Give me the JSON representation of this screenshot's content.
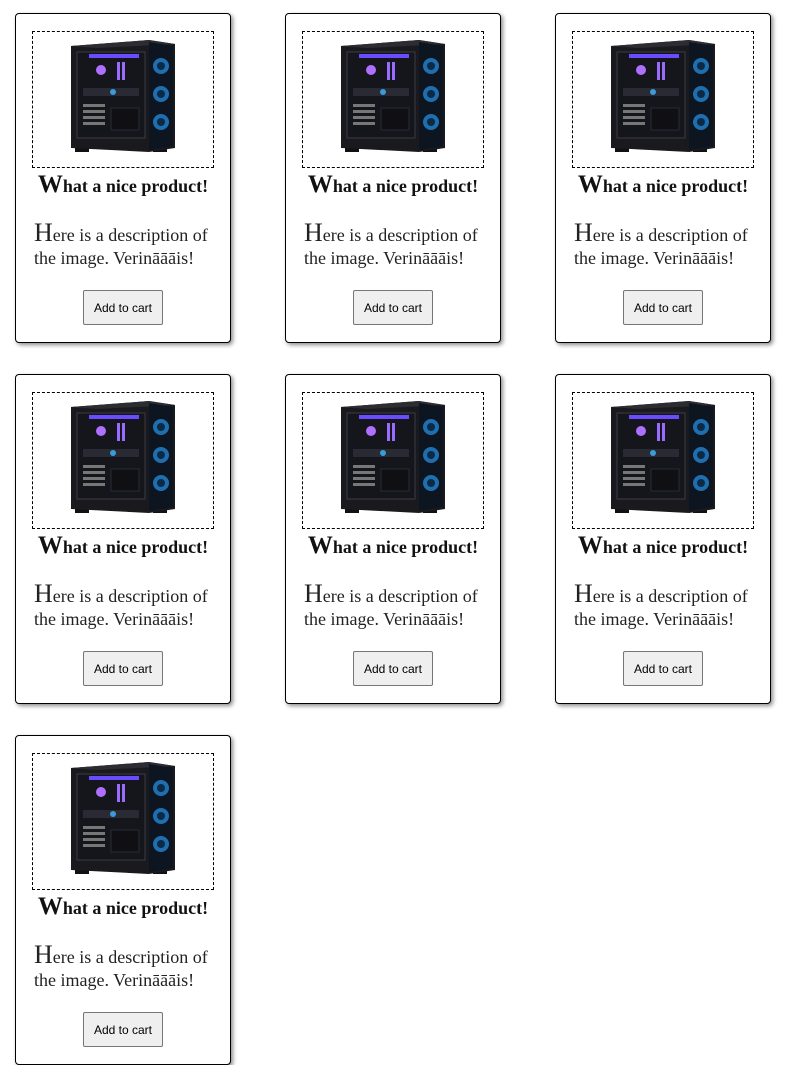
{
  "products": [
    {
      "title_initial": "W",
      "title_rest": "hat a nice product!",
      "desc_initial": "H",
      "desc_rest": "ere is a description of the image. Verināāāis!",
      "button_label": "Add to cart",
      "image_icon": "pc-tower-icon"
    },
    {
      "title_initial": "W",
      "title_rest": "hat a nice product!",
      "desc_initial": "H",
      "desc_rest": "ere is a description of the image. Verināāāis!",
      "button_label": "Add to cart",
      "image_icon": "pc-tower-icon"
    },
    {
      "title_initial": "W",
      "title_rest": "hat a nice product!",
      "desc_initial": "H",
      "desc_rest": "ere is a description of the image. Verināāāis!",
      "button_label": "Add to cart",
      "image_icon": "pc-tower-icon"
    },
    {
      "title_initial": "W",
      "title_rest": "hat a nice product!",
      "desc_initial": "H",
      "desc_rest": "ere is a description of the image. Verināāāis!",
      "button_label": "Add to cart",
      "image_icon": "pc-tower-icon"
    },
    {
      "title_initial": "W",
      "title_rest": "hat a nice product!",
      "desc_initial": "H",
      "desc_rest": "ere is a description of the image. Verināāāis!",
      "button_label": "Add to cart",
      "image_icon": "pc-tower-icon"
    },
    {
      "title_initial": "W",
      "title_rest": "hat a nice product!",
      "desc_initial": "H",
      "desc_rest": "ere is a description of the image. Verināāāis!",
      "button_label": "Add to cart",
      "image_icon": "pc-tower-icon"
    },
    {
      "title_initial": "W",
      "title_rest": "hat a nice product!",
      "desc_initial": "H",
      "desc_rest": "ere is a description of the image. Verināāāis!",
      "button_label": "Add to cart",
      "image_icon": "pc-tower-icon"
    }
  ]
}
